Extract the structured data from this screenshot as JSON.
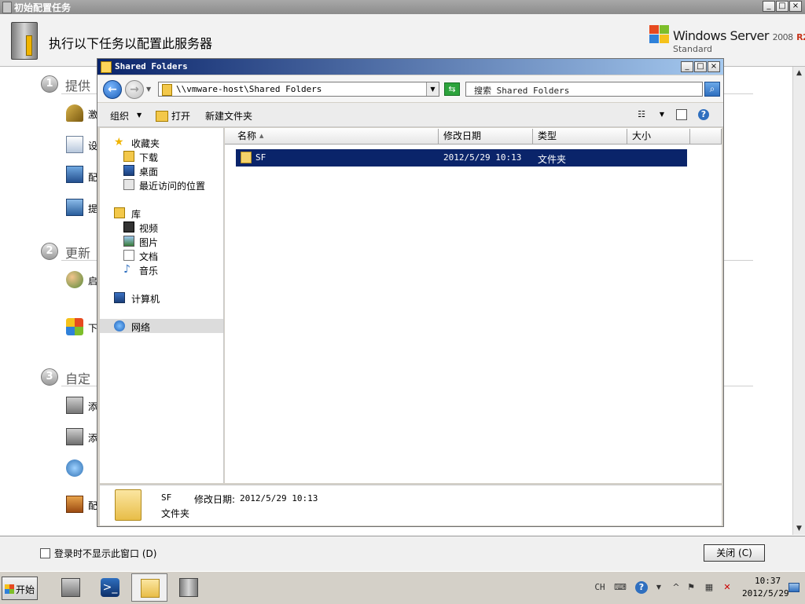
{
  "bg_window": {
    "title": "初始配置任务",
    "header_text": "执行以下任务以配置此服务器",
    "logo": {
      "brand": "Windows Server",
      "version": "2008",
      "r2": "R2",
      "edition": "Standard"
    },
    "sections": [
      {
        "num": "1",
        "title": "提供",
        "tasks": [
          "激",
          "设",
          "配",
          "提"
        ]
      },
      {
        "num": "2",
        "title": "更新",
        "tasks": [
          "启",
          "下"
        ]
      },
      {
        "num": "3",
        "title": "自定",
        "tasks": [
          "添",
          "添",
          "",
          "配"
        ]
      }
    ],
    "footer": {
      "checkbox_label": "登录时不显示此窗口 (D)",
      "close_label": "关闭 (C)"
    },
    "caption_buttons": {
      "minimize": "_",
      "maximize": "□",
      "close": "×"
    }
  },
  "explorer": {
    "title": "Shared Folders",
    "address": "\\\\vmware-host\\Shared Folders",
    "search_placeholder": "搜索 Shared Folders",
    "toolbar": {
      "organize": "组织",
      "open": "打开",
      "new_folder": "新建文件夹"
    },
    "nav": {
      "favorites": {
        "label": "收藏夹",
        "items": [
          "下载",
          "桌面",
          "最近访问的位置"
        ]
      },
      "libraries": {
        "label": "库",
        "items": [
          "视频",
          "图片",
          "文档",
          "音乐"
        ]
      },
      "computer": "计算机",
      "network": "网络"
    },
    "columns": [
      "名称",
      "修改日期",
      "类型",
      "大小"
    ],
    "rows": [
      {
        "name": "SF",
        "modified": "2012/5/29 10:13",
        "type": "文件夹",
        "size": ""
      }
    ],
    "details": {
      "name": "SF",
      "modified_label": "修改日期:",
      "modified_value": "2012/5/29 10:13",
      "type": "文件夹"
    },
    "caption_buttons": {
      "minimize": "_",
      "maximize": "□",
      "close": "×"
    }
  },
  "taskbar": {
    "start_label": "开始",
    "language": "CH",
    "clock_time": "10:37",
    "clock_date": "2012/5/29"
  }
}
